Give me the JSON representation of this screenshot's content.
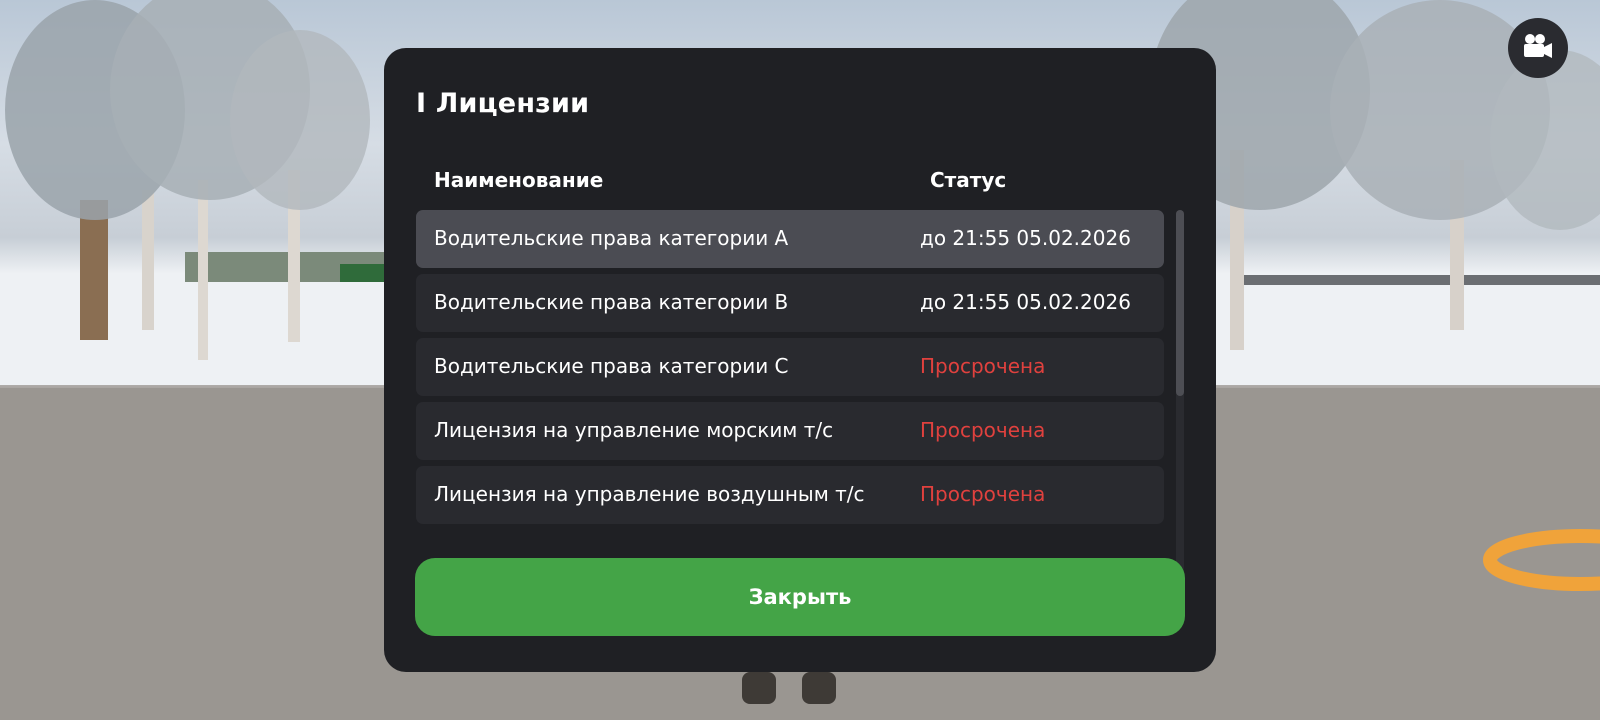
{
  "panel": {
    "title": "I Лицензии",
    "columns": {
      "name": "Наименование",
      "status": "Статус"
    },
    "rows": [
      {
        "name": "Водительские права категории A",
        "status": "до 21:55 05.02.2026",
        "status_color": "#ffffff",
        "selected": true
      },
      {
        "name": "Водительские права категории B",
        "status": "до 21:55 05.02.2026",
        "status_color": "#ffffff",
        "selected": false
      },
      {
        "name": "Водительские права категории C",
        "status": "Просрочена",
        "status_color": "#e0413e",
        "selected": false
      },
      {
        "name": "Лицензия на управление морским т/с",
        "status": "Просрочена",
        "status_color": "#e0413e",
        "selected": false
      },
      {
        "name": "Лицензия на управление воздушным т/с",
        "status": "Просрочена",
        "status_color": "#e0413e",
        "selected": false
      }
    ],
    "close_label": "Закрыть"
  },
  "hud": {
    "camera_icon": "video-camera-icon"
  },
  "colors": {
    "panel_bg": "#1f2024",
    "row_bg": "#292a2f",
    "row_selected_bg": "#4b4c53",
    "close_button": "#44a447",
    "expired_text": "#e0413e"
  }
}
